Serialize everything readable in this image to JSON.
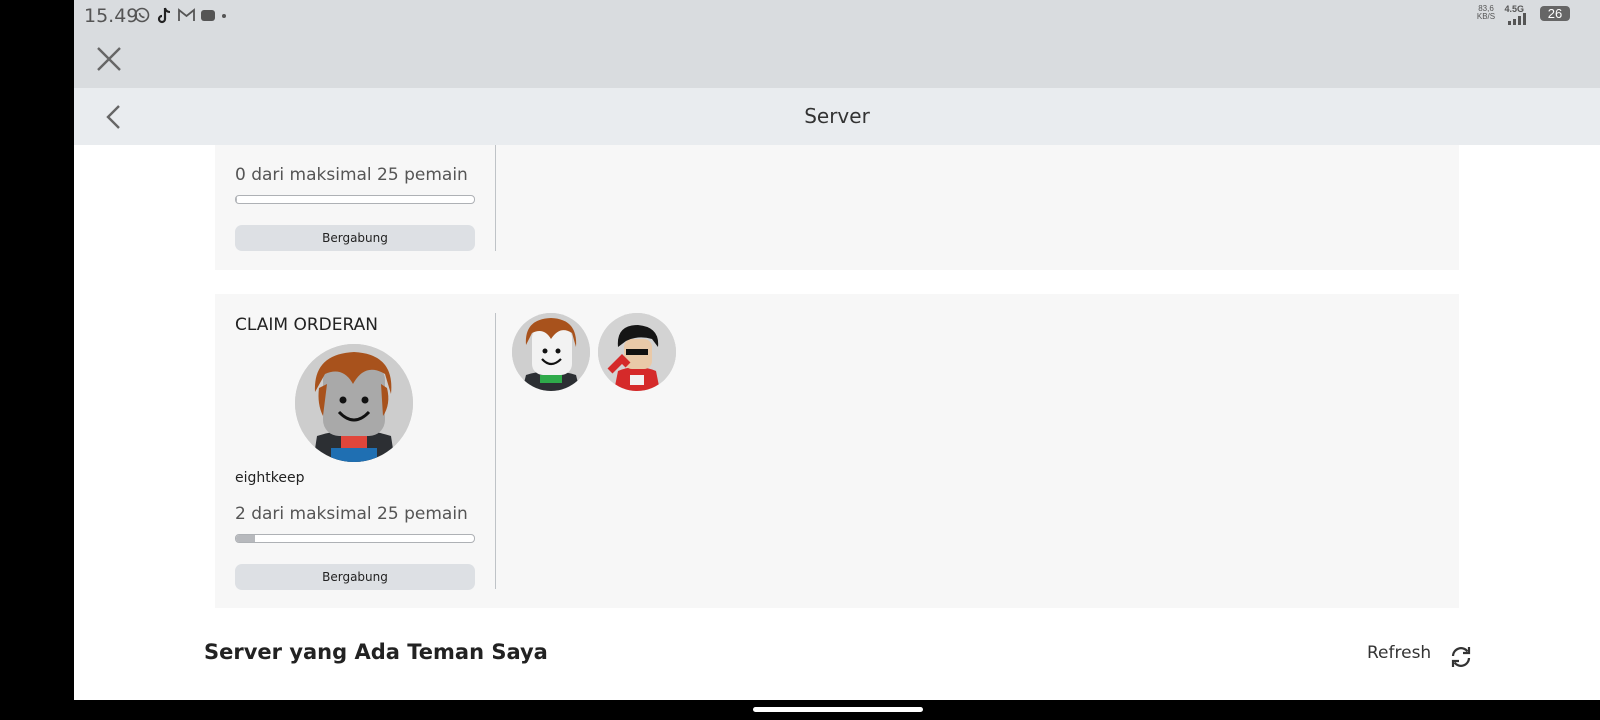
{
  "status_bar": {
    "time": "15.49",
    "net_speed_top": "83,6",
    "net_speed_bottom": "KB/S",
    "network": "4.5G",
    "battery": "26",
    "icons": [
      "whatsapp-icon",
      "tiktok-icon",
      "gmail-icon",
      "wallet-icon",
      "dot-icon"
    ]
  },
  "header": {
    "close_icon": "close-icon",
    "back_icon": "chevron-left-icon",
    "title": "Server"
  },
  "servers": [
    {
      "name": "",
      "owner": "",
      "player_count_text": "0 dari maksimal 25 pemain",
      "players": 0,
      "max_players": 25,
      "join_label": "Bergabung"
    },
    {
      "name": "CLAIM ORDERAN",
      "owner": "eightkeep",
      "player_count_text": "2 dari maksimal 25 pemain",
      "players": 2,
      "max_players": 25,
      "join_label": "Bergabung"
    }
  ],
  "friends_section": {
    "title": "Server yang Ada Teman Saya",
    "refresh_label": "Refresh",
    "refresh_icon": "refresh-icon"
  },
  "colors": {
    "header_bg": "#d9dcdf",
    "titlebar_bg": "#e9ecef",
    "card_bg": "#f7f7f7",
    "button_bg": "#dde0e4"
  }
}
